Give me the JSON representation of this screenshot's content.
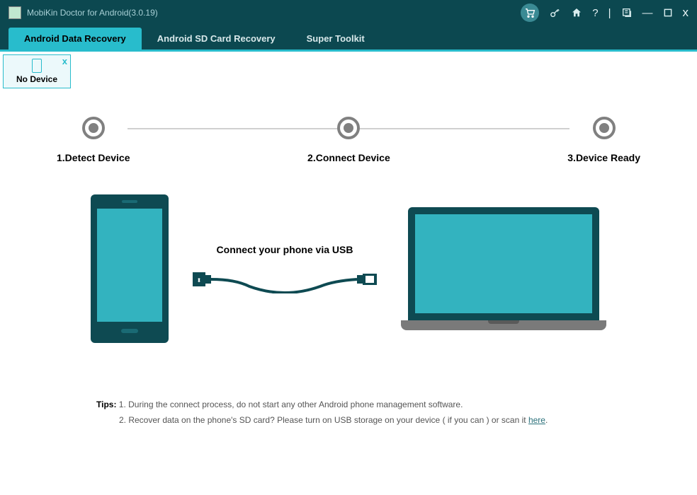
{
  "title": "MobiKin Doctor for Android(3.0.19)",
  "tabs": {
    "recovery": "Android Data Recovery",
    "sdcard": "Android SD Card Recovery",
    "toolkit": "Super Toolkit"
  },
  "device_box": {
    "label": "No Device",
    "close": "x"
  },
  "steps": {
    "s1": "1.Detect Device",
    "s2": "2.Connect Device",
    "s3": "3.Device Ready"
  },
  "connect_text": "Connect your phone via USB",
  "tips": {
    "label": "Tips:",
    "t1": "1. During the connect process, do not start any other Android phone management software.",
    "t2a": "2. Recover data on the phone's SD card? Please turn on USB storage on your device ( if you can ) or scan it ",
    "t2link": "here",
    "t2b": "."
  },
  "window_controls": {
    "help": "?",
    "divider": "|",
    "minimize": "—",
    "close": "x"
  }
}
